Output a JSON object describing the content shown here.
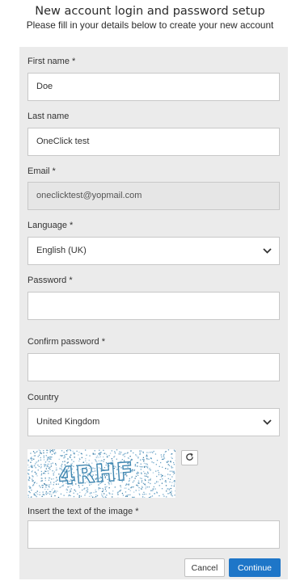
{
  "header": {
    "title": "New account login and password setup",
    "subtitle": "Please fill in your details below to create your new account"
  },
  "form": {
    "first_name": {
      "label": "First name *",
      "value": "Doe"
    },
    "last_name": {
      "label": "Last name",
      "value": "OneClick test"
    },
    "email": {
      "label": "Email *",
      "value": "oneclicktest@yopmail.com"
    },
    "language": {
      "label": "Language *",
      "value": "English (UK)"
    },
    "password": {
      "label": "Password *",
      "value": ""
    },
    "confirm_password": {
      "label": "Confirm password *",
      "value": ""
    },
    "country": {
      "label": "Country",
      "value": "United Kingdom"
    },
    "captcha": {
      "label": "Insert the text of the image *",
      "image_text": "4RHF",
      "value": ""
    }
  },
  "actions": {
    "cancel_label": "Cancel",
    "continue_label": "Continue"
  },
  "colors": {
    "panel": "#ebebeb",
    "primary": "#1e76c8",
    "captcha_ink": "#4a8bb0"
  },
  "icons": {
    "select_chevron": "chevron-down-icon",
    "refresh": "refresh-icon"
  }
}
